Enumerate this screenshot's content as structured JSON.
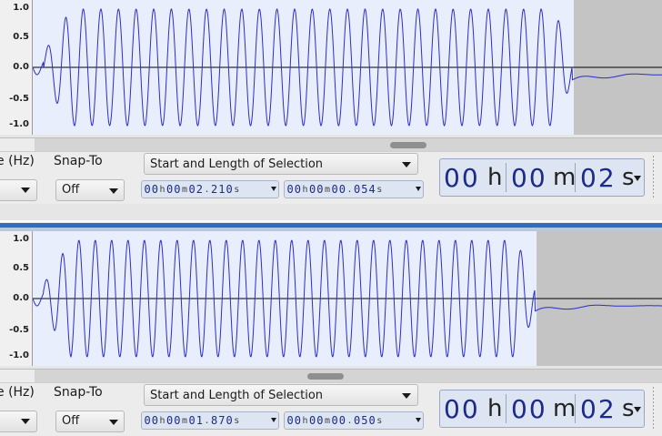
{
  "colors": {
    "waveform": "#2b2ecc",
    "selection_bg": "#e8eefb",
    "unselected_bg": "#c4c4c4",
    "track_split": "#2e6fbd"
  },
  "tracks": [
    {
      "id": "a",
      "ruler": [
        "1.0",
        "0.5",
        "0.0",
        "-0.5",
        "-1.0"
      ],
      "selection_fraction": 0.86,
      "cycles": 30,
      "toolbar": {
        "rate_label": "e (Hz)",
        "snap_label": "Snap-To",
        "snap_value": "Off",
        "selection_mode": "Start and Length of Selection",
        "start": [
          "0",
          "0",
          "h",
          "0",
          "0",
          "m",
          "0",
          "2",
          ".",
          "2",
          "1",
          "0",
          "s"
        ],
        "length": [
          "0",
          "0",
          "h",
          "0",
          "0",
          "m",
          "0",
          "0",
          ".",
          "0",
          "5",
          "4",
          "s"
        ],
        "big": {
          "h": "00",
          "m": "00",
          "s": "02",
          "h_unit": "h",
          "m_unit": "m",
          "s_unit": "s"
        }
      }
    },
    {
      "id": "b",
      "ruler": [
        "1.0",
        "0.5",
        "0.0",
        "-0.5",
        "-1.0"
      ],
      "selection_fraction": 0.8,
      "cycles": 30,
      "toolbar": {
        "rate_label": "e (Hz)",
        "snap_label": "Snap-To",
        "snap_value": "Off",
        "selection_mode": "Start and Length of Selection",
        "start": [
          "0",
          "0",
          "h",
          "0",
          "0",
          "m",
          "0",
          "1",
          ".",
          "8",
          "7",
          "0",
          "s"
        ],
        "length": [
          "0",
          "0",
          "h",
          "0",
          "0",
          "m",
          "0",
          "0",
          ".",
          "0",
          "5",
          "0",
          "s"
        ],
        "big": {
          "h": "00",
          "m": "00",
          "s": "02",
          "h_unit": "h",
          "m_unit": "m",
          "s_unit": "s"
        }
      }
    }
  ]
}
